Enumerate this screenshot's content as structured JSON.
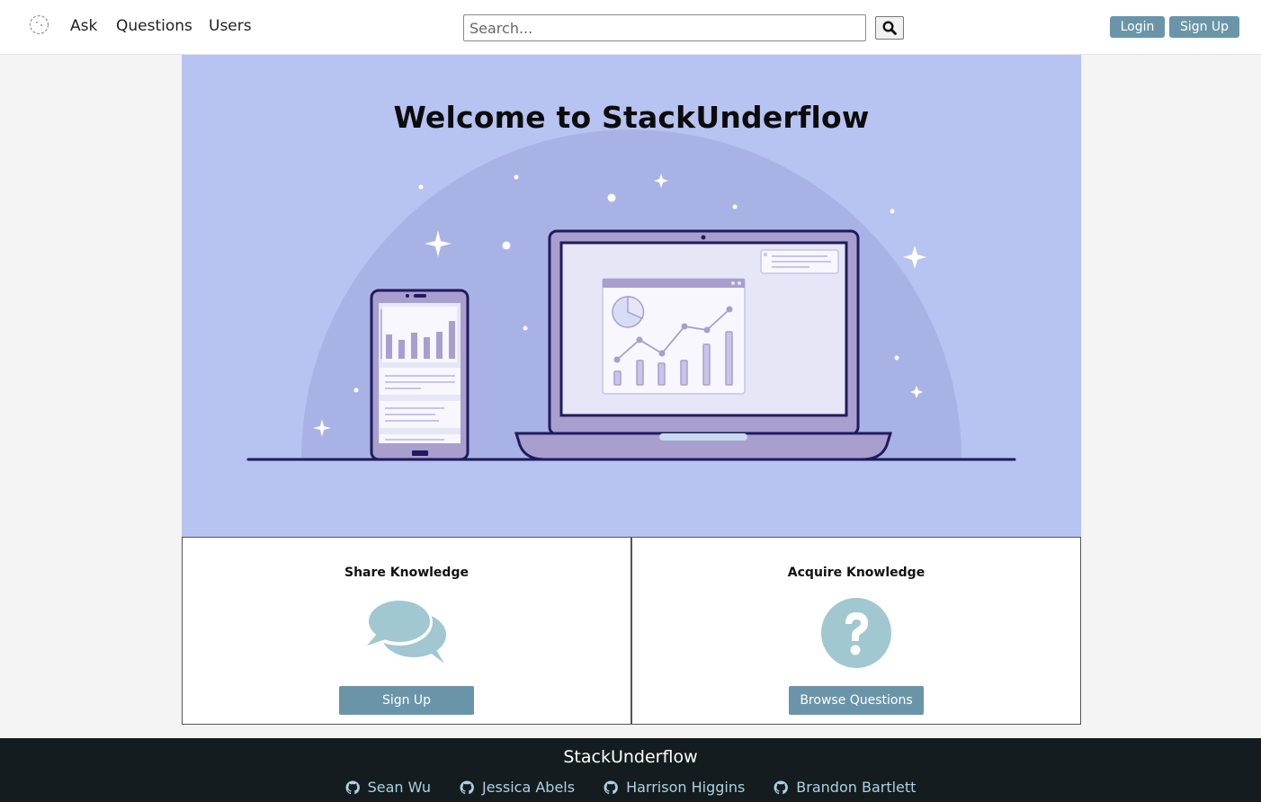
{
  "navbar": {
    "logo_icon": "stack-logo-icon",
    "links": [
      "Ask",
      "Questions",
      "Users"
    ],
    "search": {
      "placeholder": "Search...",
      "value": ""
    },
    "search_icon": "search-icon",
    "login_label": "Login",
    "signup_label": "Sign Up"
  },
  "hero": {
    "title": "Welcome to StackUnderflow"
  },
  "cards": [
    {
      "title": "Share Knowledge",
      "icon": "comments-icon",
      "button_label": "Sign Up"
    },
    {
      "title": "Acquire Knowledge",
      "icon": "question-circle-icon",
      "button_label": "Browse Questions"
    }
  ],
  "footer": {
    "title": "StackUnderflow",
    "links": [
      "Sean Wu",
      "Jessica Abels",
      "Harrison Higgins",
      "Brandon Bartlett"
    ],
    "link_icon": "github-icon"
  },
  "colors": {
    "accent": "#6a95a9",
    "hero_bg": "#b7c3f0",
    "footer_bg": "#151c1f",
    "footer_link": "#a9d3e3",
    "card_icon": "#a1c7d1"
  }
}
